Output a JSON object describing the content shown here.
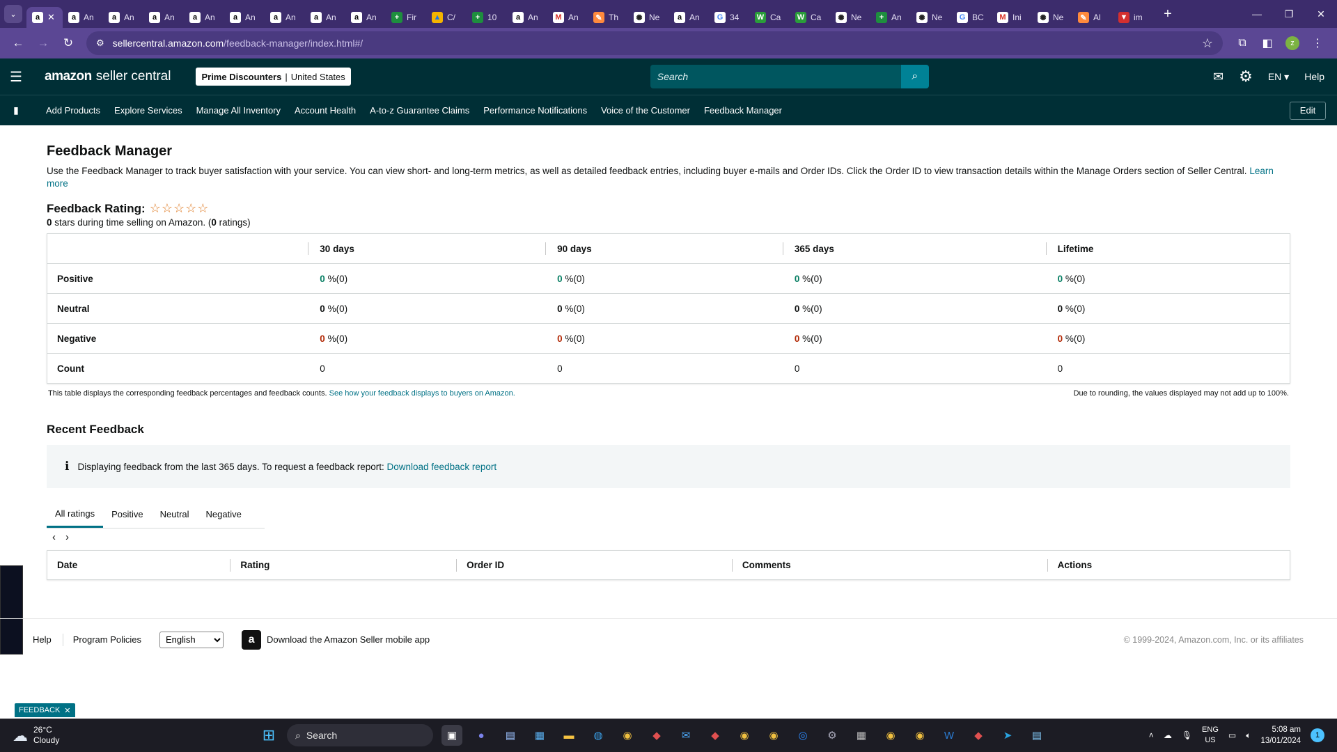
{
  "browser": {
    "tabs": [
      {
        "icon": "amazon-icon",
        "label": "a",
        "active": true
      },
      {
        "icon": "amazon-icon",
        "label": "An"
      },
      {
        "icon": "amazon-icon",
        "label": "An"
      },
      {
        "icon": "amazon-icon",
        "label": "An"
      },
      {
        "icon": "amazon-icon",
        "label": "An"
      },
      {
        "icon": "amazon-icon",
        "label": "An"
      },
      {
        "icon": "amazon-icon",
        "label": "An"
      },
      {
        "icon": "amazon-icon",
        "label": "An"
      },
      {
        "icon": "amazon-icon",
        "label": "An"
      },
      {
        "icon": "sheets-icon",
        "label": "Fir"
      },
      {
        "icon": "drive-icon",
        "label": "C/"
      },
      {
        "icon": "sheets-icon",
        "label": "10"
      },
      {
        "icon": "amazon-icon",
        "label": "An"
      },
      {
        "icon": "gmail-icon",
        "label": "An"
      },
      {
        "icon": "pen-icon",
        "label": "Th"
      },
      {
        "icon": "openai-icon",
        "label": "Ne"
      },
      {
        "icon": "amazon-icon",
        "label": "An"
      },
      {
        "icon": "google-icon",
        "label": "34"
      },
      {
        "icon": "w-icon",
        "label": "Ca"
      },
      {
        "icon": "w-icon",
        "label": "Ca"
      },
      {
        "icon": "openai-icon",
        "label": "Ne"
      },
      {
        "icon": "sheets-icon",
        "label": "An"
      },
      {
        "icon": "openai-icon",
        "label": "Ne"
      },
      {
        "icon": "google-icon",
        "label": "BC"
      },
      {
        "icon": "gmail-icon",
        "label": "Ini"
      },
      {
        "icon": "openai-icon",
        "label": "Ne"
      },
      {
        "icon": "pen-icon",
        "label": "Al"
      },
      {
        "icon": "flag-icon",
        "label": "im"
      }
    ],
    "url_host": "sellercentral.amazon.com",
    "url_path": "/feedback-manager/index.html#/",
    "profile_initial": "z"
  },
  "header": {
    "logo_brand": "amazon",
    "logo_product": "seller central",
    "store_name": "Prime Discounters",
    "marketplace": "United States",
    "search_placeholder": "Search",
    "language": "EN ▾",
    "help": "Help"
  },
  "nav": {
    "links": [
      "Add Products",
      "Explore Services",
      "Manage All Inventory",
      "Account Health",
      "A-to-z Guarantee Claims",
      "Performance Notifications",
      "Voice of the Customer",
      "Feedback Manager"
    ],
    "edit": "Edit"
  },
  "page": {
    "title": "Feedback Manager",
    "intro": "Use the Feedback Manager to track buyer satisfaction with your service. You can view short- and long-term metrics, as well as detailed feedback entries, including buyer e-mails and Order IDs. Click the Order ID to view transaction details within the Manage Orders section of Seller Central.",
    "learn_more": "Learn more",
    "rating_title": "Feedback Rating:",
    "stars": "☆☆☆☆☆",
    "stars_value": "0",
    "rating_sub_mid": " stars during time selling on Amazon. (",
    "ratings_count": "0",
    "rating_sub_end": " ratings)"
  },
  "metrics": {
    "columns": [
      "30 days",
      "90 days",
      "365 days",
      "Lifetime"
    ],
    "rows": [
      {
        "label": "Positive",
        "kind": "pos",
        "cells": [
          {
            "num": "0",
            "rest": " %(0)"
          },
          {
            "num": "0",
            "rest": " %(0)"
          },
          {
            "num": "0",
            "rest": " %(0)"
          },
          {
            "num": "0",
            "rest": " %(0)"
          }
        ]
      },
      {
        "label": "Neutral",
        "kind": "neu",
        "cells": [
          {
            "num": "0",
            "rest": " %(0)"
          },
          {
            "num": "0",
            "rest": " %(0)"
          },
          {
            "num": "0",
            "rest": " %(0)"
          },
          {
            "num": "0",
            "rest": " %(0)"
          }
        ]
      },
      {
        "label": "Negative",
        "kind": "neg",
        "cells": [
          {
            "num": "0",
            "rest": " %(0)"
          },
          {
            "num": "0",
            "rest": " %(0)"
          },
          {
            "num": "0",
            "rest": " %(0)"
          },
          {
            "num": "0",
            "rest": " %(0)"
          }
        ]
      },
      {
        "label": "Count",
        "kind": "count",
        "cells": [
          {
            "num": "",
            "rest": "0"
          },
          {
            "num": "",
            "rest": "0"
          },
          {
            "num": "",
            "rest": "0"
          },
          {
            "num": "",
            "rest": "0"
          }
        ]
      }
    ],
    "note_left": "This table displays the corresponding feedback percentages and feedback counts.",
    "note_link": "See how your feedback displays to buyers on Amazon.",
    "note_right": "Due to rounding, the values displayed may not add up to 100%."
  },
  "recent": {
    "title": "Recent Feedback",
    "info_text": "Displaying feedback from the last 365 days. To request a feedback report:",
    "info_link": "Download feedback report",
    "tabs": [
      "All ratings",
      "Positive",
      "Neutral",
      "Negative"
    ],
    "active_tab": "All ratings",
    "columns": [
      "Date",
      "Rating",
      "Order ID",
      "Comments",
      "Actions"
    ]
  },
  "footer": {
    "help": "Help",
    "policies": "Program Policies",
    "language_selected": "English",
    "app_promo": "Download the Amazon Seller mobile app",
    "copyright": "© 1999-2024, Amazon.com, Inc. or its affiliates",
    "feedback_pill": "FEEDBACK"
  },
  "taskbar": {
    "temp": "26°C",
    "condition": "Cloudy",
    "search": "Search",
    "lang_line1": "ENG",
    "lang_line2": "US",
    "time": "5:08 am",
    "date": "13/01/2024",
    "notifications": "1"
  },
  "colors": {
    "seller_header": "#002f36",
    "browser_frame": "#5b4794",
    "positive": "#067d62",
    "negative": "#b12704",
    "link": "#007185",
    "star": "#de7921"
  }
}
